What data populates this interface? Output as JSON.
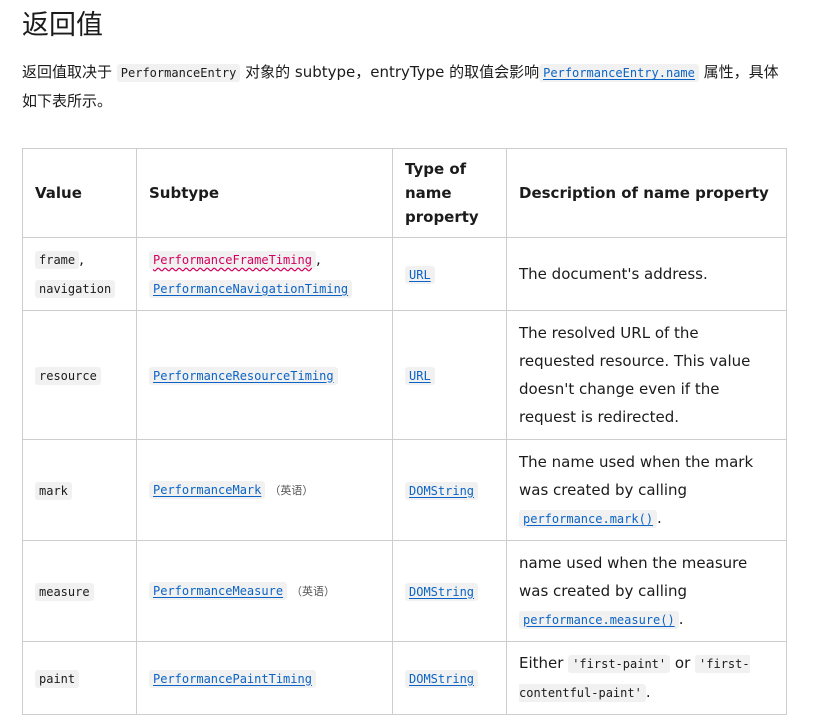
{
  "heading": "返回值",
  "intro": {
    "part1": "返回值取决于 ",
    "code1": "PerformanceEntry",
    "part2": " 对象的 subtype，entryType 的取值会影响",
    "code2": "PerformanceEntry.name",
    "part3": " 属性，具体如下表所示。"
  },
  "table": {
    "headers": {
      "value": "Value",
      "subtype": "Subtype",
      "type": "Type of name property",
      "desc": "Description of name property"
    },
    "rows": [
      {
        "value_a": "frame",
        "sep": ",",
        "value_b": "navigation",
        "subtype_a": "PerformanceFrameTiming",
        "subtype_b": "PerformanceNavigationTiming",
        "type": "URL",
        "desc": "The document's address."
      },
      {
        "value": "resource",
        "subtype": "PerformanceResourceTiming",
        "type": "URL",
        "desc": "The resolved URL of the requested resource. This value doesn't change even if the request is redirected."
      },
      {
        "value": "mark",
        "subtype": "PerformanceMark",
        "subtype_note": "（英语）",
        "type": "DOMString",
        "desc": "The name used when the mark was created by calling ",
        "desc_code": "performance.mark()",
        "desc_end": "."
      },
      {
        "value": "measure",
        "subtype": "PerformanceMeasure",
        "subtype_note": "（英语）",
        "type": "DOMString",
        "desc": "name used when the measure was created by calling ",
        "desc_code": "performance.measure()",
        "desc_end": "."
      },
      {
        "value": "paint",
        "subtype": "PerformancePaintTiming",
        "type": "DOMString",
        "desc_pre": "Either ",
        "desc_code1": "'first-paint'",
        "desc_mid": " or ",
        "desc_code2": "'first-contentful-paint'",
        "desc_end": "."
      }
    ]
  },
  "colors": {
    "link": "#0b64c5",
    "wavy_error": "#d3005d",
    "border": "#cdcdcd",
    "code_bg": "#f2f1f1"
  }
}
